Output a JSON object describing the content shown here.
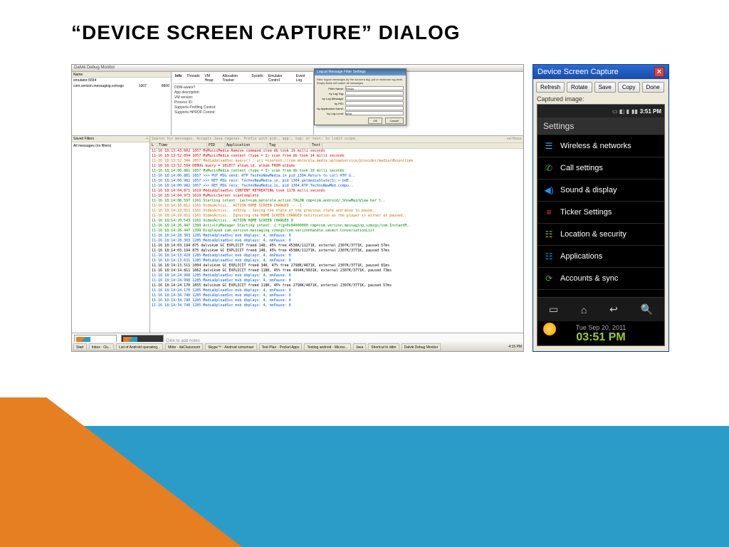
{
  "title": "“DEVICE SCREEN CAPTURE” DIALOG",
  "ddms": {
    "window_title": "Dalvik Debug Monitor",
    "devices_header": "Name",
    "device_name": "emulator-5554",
    "process": "com.verizon.messaging.vzmsgs",
    "pid": "1007",
    "port": "8600",
    "tabs": [
      "Info",
      "Threads",
      "VM Heap",
      "Allocation Tracker",
      "Sysinfo",
      "Emulator Control",
      "Event Log"
    ],
    "info": [
      "DDM-aware?",
      "App description:",
      "VM version:",
      "Process ID:",
      "Supports Profiling Control:",
      "Supports HPROF Control:"
    ],
    "filters_header": "Saved Filters",
    "filters_all": "All messages (no filters)",
    "log_search": "Search for messages. Accepts Java regexes. Prefix with pid:, app:, tag: or text: to limit scope.",
    "log_verbose": "verbose",
    "log_headers": [
      "L",
      "Time",
      "PID",
      "Application",
      "Tag",
      "Text"
    ],
    "notes": "Click to add notes"
  },
  "filter_dlg": {
    "title": "Logcat Message Filter Settings",
    "desc": "Filter logcat messages by the source's tag, pid or minimum log level. Empty fields will match all messages.",
    "fields": [
      "Filter Name:",
      "by Log Tag:",
      "by Log Message:",
      "by PID:",
      "by Application Name:",
      "by Log Level:"
    ],
    "name_val": "Errors",
    "level_val": "error",
    "ok": "OK",
    "cancel": "Cancel"
  },
  "logs": [
    {
      "c": "log-red",
      "t": "11-16 18:13:43.602  1057  MyMusicMedia  Remove command item db took 19 milli seconds"
    },
    {
      "c": "log-red",
      "t": "11-16 18:13:52.094  1057  MyMusicMedia  content (type = 2) scan from db took 14 milli seconds"
    },
    {
      "c": "log-orange",
      "t": "11-16 18:13:52.344  1057  MediaUploadSvc  query() : uri =content://com.motorola.media.uploadservice/provider/media/dbsynctime"
    },
    {
      "c": "log-red",
      "t": "11-16 18:13:52.594        DEBUG  query = SELECT album.id, album FROM albums"
    },
    {
      "c": "log-green",
      "t": "11-16 18:14:00.881  1057  MyMusicMedia  content (type = 3) scan from db took 10 milli seconds"
    },
    {
      "c": "log-blue",
      "t": "11-16 18:14:00.881  1057                >>> PUT_MSG send: RTP TechnoNewMedia.in pid 1304.Return to call RTP G.."
    },
    {
      "c": "log-blue",
      "t": "11-16 18:14:00.982  1057                >>> RET_MSG recv: TechnoNewMedia.in, pid 1304.getmediaState(S) > bdE.."
    },
    {
      "c": "log-blue",
      "t": "11-16 18:14:00.982  1057                >>> RET_MSG recv: TechnoNewMedia.in, pid 1304.RTP.TechnoNewMed.compu.."
    },
    {
      "c": "log-red",
      "t": "11-16 18:14:04.871  1619  MediaUploadSvc CONTENT RETREATING took 1178 milli seconds"
    },
    {
      "c": "log-red",
      "t": "11-16 18:14:04.973  1619  MyMusicServer  scanComplete"
    },
    {
      "c": "log-green",
      "t": "11-16 18:14:08.597  1161                Starting intent: {act=com.motorola.action.TALON cmp=com.android/.ShowMainView har t.."
    },
    {
      "c": "log-orange",
      "t": "11-16 18:14:16.812  1161  VideoActivi.. ACTION HOME SCREEN CHANGED -- -1"
    },
    {
      "c": "log-orange",
      "t": "11-16 18:14:19.011  1161  VideoActivi.. onStop : Saving the state of the previous state and move to pause.."
    },
    {
      "c": "log-orange",
      "t": "11-16 18:14:19.011  1161  VideoActivi.. Ignoring the HOME SCREEN CHANGED notification as the player is either at paused.."
    },
    {
      "c": "log-green",
      "t": "11-16 18:14:20.543  1161  VideoActivi.. ACTION HOME SCREEN CHANGED 0"
    },
    {
      "c": "log-green",
      "t": "11-16 18:14:26.447  1399  ActivityManager Starting intent: { flg=0x04000000 cmp=com.verizon.messaging.vzmsgs/com.InstantM.."
    },
    {
      "c": "log-green",
      "t": "11-16 18:14:26.447  1399                Displayed com.verizon.messaging.vzmsgs/com.verizonhandle.smsmit.ConversationList"
    },
    {
      "c": "log-blue",
      "t": "11-16 18:14:28.303  1285  MediaUploadSvc  mvb dbplays: 4, mnPause: 0"
    },
    {
      "c": "log-blue",
      "t": "11-16 18:14:28.303  1285  MediaUploadSvc  mvb dbplays: 4, mnPause: 0"
    },
    {
      "c": "log-black",
      "t": "11-16 18:14:03.194   875  dalvikvm  GC EXPLICIT freed 148, 45% free 4538K/11271K, external 2307K/3771K, paused 57ms"
    },
    {
      "c": "log-black",
      "t": "11-16 18:14:03.194   875  dalvikvm  GC EXPLICIT freed 148, 45% free 4538K/11271K, external 2307K/3771K, paused 57ms"
    },
    {
      "c": "log-blue",
      "t": "11-16 18:14:13.428  1285  MediaUploadSvc  mvb dbplays: 4, mnPause: 0"
    },
    {
      "c": "log-blue",
      "t": "11-16 18:14:13.631  1285  MediaUploadSvc  mvb dbplays: 4, mnPause: 0"
    },
    {
      "c": "log-black",
      "t": "11-16 18:14:13.511  1004  dalvikvm  GC EXPLICIT freed 34K, 47% free 2798K/4871K, external 2307K/3771K, paused 81ms"
    },
    {
      "c": "log-black",
      "t": "11-16 18:14:14.811  1062  dalvikvm  GC EXPLICIT freed 118K, 45% free 4994K/9031K, external 2307K/3771K, paused 73ms"
    },
    {
      "c": "log-blue",
      "t": "11-16 18:14:24.998  1285  MediaUploadSvc  mvb dbplays: 4, mnPause: 0"
    },
    {
      "c": "log-blue",
      "t": "11-16 18:14:24.998  1285  MediaUploadSvc  mvb dbplays: 4, mnPause: 0"
    },
    {
      "c": "log-black",
      "t": "11-16 18:14:24.170  1055  dalvikvm  GC EXPLICIT freed 118K, 45% free 2798K/4871K, external 2307K/3771K, paused 57ms"
    },
    {
      "c": "log-blue",
      "t": "11-16 18:14:24.170  1285  MediaUploadSvc  mvb dbplays: 4, mnPause: 0"
    },
    {
      "c": "log-blue",
      "t": "11-16 18:14:34.740  1285  MediaUploadSvc  mvb dbplays: 4, mnPause: 0"
    },
    {
      "c": "log-blue",
      "t": "11-16 18:14:34.740  1285  MediaUploadSvc  mvb dbplays: 4, mnPause: 0"
    },
    {
      "c": "log-blue",
      "t": "11-16 18:14:34.740  1285  MediaUploadSvc  mvb dbplays: 4, mnPause: 0"
    }
  ],
  "taskbar": [
    "Start",
    "Inbox - Ou...",
    "List of Android operating...",
    "Mitre - daClassroom",
    "Skype™ - Android vzmsmser",
    "Test Plan - Pocket Apps",
    "Testing android - Micros...",
    "Java",
    "Shortcut to ddm",
    "Dalvik Debug Monitor"
  ],
  "taskbar_time": "4:15 PM",
  "dsc": {
    "title": "Device Screen Capture",
    "buttons": [
      "Refresh",
      "Rotate",
      "Save",
      "Copy",
      "Done"
    ],
    "label": "Captured image:"
  },
  "android": {
    "status_time": "3:51 PM",
    "header": "Settings",
    "items": [
      {
        "icon": "☰",
        "color": "#3cb4e7",
        "label": "Wireless & networks"
      },
      {
        "icon": "✆",
        "color": "#4caf50",
        "label": "Call settings"
      },
      {
        "icon": "◀)",
        "color": "#2196f3",
        "label": "Sound & display"
      },
      {
        "icon": "≡",
        "color": "#f44336",
        "label": "Ticker Settings"
      },
      {
        "icon": "☷",
        "color": "#8bc34a",
        "label": "Location & security"
      },
      {
        "icon": "☷",
        "color": "#03a9f4",
        "label": "Applications"
      },
      {
        "icon": "⟳",
        "color": "#4caf50",
        "label": "Accounts & sync"
      }
    ],
    "date": "Tue Sep  20, 2011",
    "time": "03:51 PM"
  }
}
